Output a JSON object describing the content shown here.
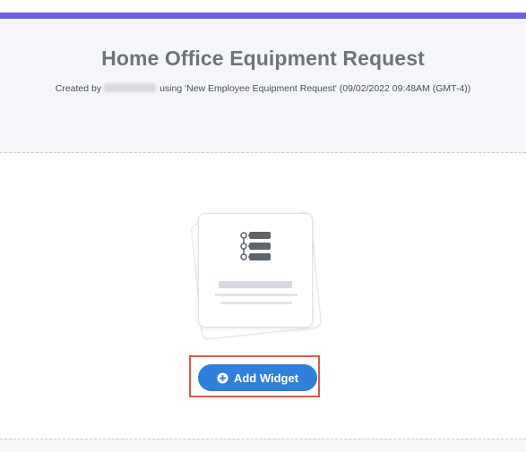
{
  "header": {
    "title": "Home Office Equipment Request",
    "created_prefix": "Created by",
    "created_suffix": "using 'New Employee Equipment Request' (09/02/2022 09:48AM (GMT-4))"
  },
  "widget_placeholder": {
    "icon": "list-icon"
  },
  "actions": {
    "add_widget_label": "Add Widget",
    "add_widget_icon": "plus-circle-icon"
  },
  "colors": {
    "accent": "#6b63e6",
    "button": "#2f7fdb",
    "highlight": "#e05a4a",
    "title": "#6f747b"
  }
}
